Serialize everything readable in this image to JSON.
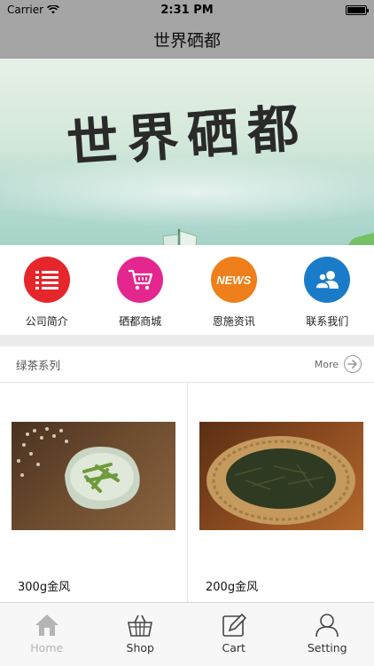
{
  "status_bar": {
    "carrier": "Carrier",
    "time": "2:31 PM"
  },
  "nav": {
    "title": "世界硒都"
  },
  "banner": {
    "title": "世界硒都",
    "active_slide": 1,
    "slide_count": 1
  },
  "menu": {
    "items": [
      {
        "label": "公司简介",
        "icon": "list-icon",
        "color": "#e5262a"
      },
      {
        "label": "硒都商城",
        "icon": "cart-icon",
        "color": "#e4268f"
      },
      {
        "label": "恩施资讯",
        "icon": "news-icon",
        "color": "#ef7f1a",
        "icon_text": "NEWS"
      },
      {
        "label": "联系我们",
        "icon": "contacts-icon",
        "color": "#1a7bc9"
      }
    ]
  },
  "section": {
    "title": "绿茶系列",
    "more_label": "More"
  },
  "products": [
    {
      "name": "300g金风"
    },
    {
      "name": "200g金风"
    }
  ],
  "tab_bar": {
    "tabs": [
      {
        "label": "Home",
        "icon": "home-icon",
        "active": false
      },
      {
        "label": "Shop",
        "icon": "basket-icon",
        "active": true
      },
      {
        "label": "Cart",
        "icon": "edit-icon",
        "active": true
      },
      {
        "label": "Setting",
        "icon": "person-icon",
        "active": true
      }
    ]
  },
  "colors": {
    "bar_gray": "#a5a5a5",
    "page_dot": "#1e7bd8"
  }
}
